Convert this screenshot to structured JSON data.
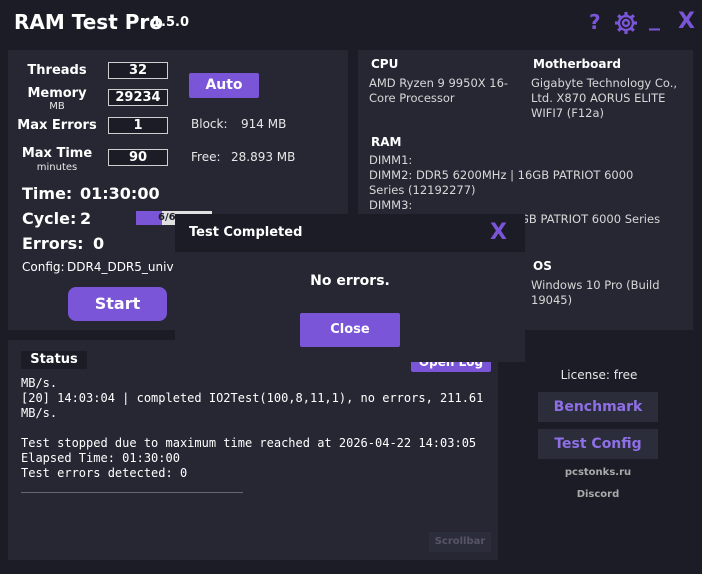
{
  "app": {
    "title": "RAM Test Pro",
    "version": "1.5.0"
  },
  "topbar": {
    "help": "?",
    "settings_icon": "gear-icon",
    "minimize": "_",
    "close": "X"
  },
  "settings": {
    "threads_label": "Threads",
    "threads_value": "32",
    "memory_label": "Memory",
    "memory_unit": "MB",
    "memory_value": "29234",
    "max_errors_label": "Max Errors",
    "max_errors_value": "1",
    "max_time_label": "Max Time",
    "max_time_unit": "minutes",
    "max_time_value": "90",
    "auto_label": "Auto",
    "block_label": "Block:",
    "block_value": "914 MB",
    "free_label": "Free:",
    "free_value": "28.893 MB"
  },
  "stats": {
    "time_label": "Time:",
    "time_value": "01:30:00",
    "cycle_label": "Cycle:",
    "cycle_value": "2",
    "cycle_progress_text": "6/6",
    "cycle_progress": 0.34,
    "errors_label": "Errors:",
    "errors_value": "0",
    "config_label": "Config:",
    "config_value": "DDR4_DDR5_univ"
  },
  "start_label": "Start",
  "system": {
    "cpu_header": "CPU",
    "cpu_value": "AMD Ryzen 9 9950X 16-Core Processor",
    "mb_header": "Motherboard",
    "mb_value": "Gigabyte Technology Co., Ltd. X870 AORUS ELITE WIFI7 (F12a)",
    "ram_header": "RAM",
    "dimm1_label": "DIMM1:",
    "dimm2_value": "DIMM2: DDR5 6200MHz | 16GB PATRIOT 6000 Series (12192277)",
    "dimm3_label": "DIMM3:",
    "dimm4_partial": "GB PATRIOT 6000 Series",
    "os_header": "OS",
    "os_value": "Windows 10 Pro (Build 19045)"
  },
  "status": {
    "header": "Status",
    "open_log_partial": "Open Log",
    "log_lines": [
      "MB/s.",
      "[20] 14:03:04 | completed IO2Test(100,8,11,1), no errors, 211.61",
      "MB/s.",
      "",
      "Test stopped due to maximum time reached at 2026-04-22 14:03:05",
      "Elapsed Time: 01:30:00",
      "Test errors detected: 0",
      "____________________________________________________"
    ],
    "scrollbar_label": "Scrollbar"
  },
  "sidebar": {
    "license": "License: free",
    "benchmark": "Benchmark",
    "test_config": "Test Config",
    "site": "pcstonks.ru",
    "discord": "Discord"
  },
  "dialog": {
    "title": "Test Completed",
    "close_x": "X",
    "message": "No errors.",
    "close_button": "Close"
  },
  "colors": {
    "accent": "#7b55d8",
    "background": "#1b1c25",
    "panel": "#262733"
  }
}
